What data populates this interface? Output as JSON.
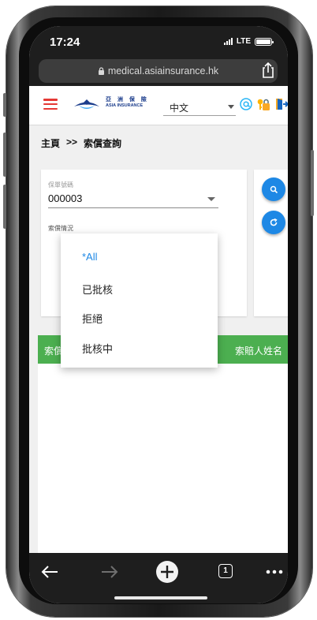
{
  "status_bar": {
    "time": "17:24",
    "network": "LTE"
  },
  "browser": {
    "url": "medical.asiainsurance.hk",
    "tab_count": "1"
  },
  "header": {
    "logo_cn": "亞 洲 保 險",
    "logo_en": "ASIA INSURANCE",
    "language": "中文",
    "brand_color": "#1c3d8c",
    "menu_color": "#e53935"
  },
  "breadcrumb": {
    "home": "主頁",
    "separator": ">>",
    "current": "索償查詢"
  },
  "search_form": {
    "policy_label": "保單號碼",
    "policy_value": "000003",
    "claim_status_label": "索償情況"
  },
  "claim_status_options": [
    {
      "label": "*All",
      "selected": true
    },
    {
      "label": "已批核",
      "selected": false
    },
    {
      "label": "拒絕",
      "selected": false
    },
    {
      "label": "批核中",
      "selected": false
    }
  ],
  "results_table": {
    "first_header_visible": "索償",
    "last_header": "索賠人姓名",
    "header_color": "#4caf50"
  },
  "accent_color": "#1e88e5"
}
